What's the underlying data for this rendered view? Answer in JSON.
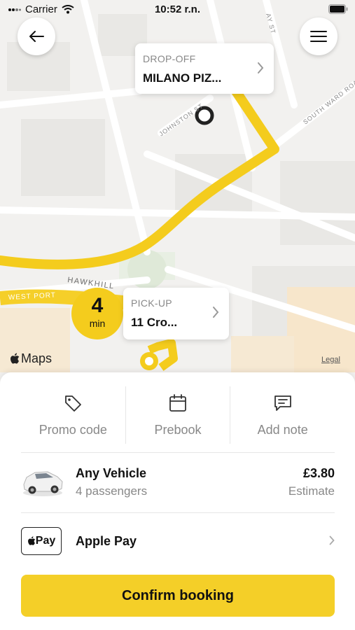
{
  "status_bar": {
    "carrier": "Carrier",
    "time": "10:52 r.n."
  },
  "map": {
    "streets": {
      "hawkhill": "HAWKHILL",
      "west_port": "WEST PORT",
      "johnston_st": "JOHNSTON ST",
      "south_ward_road": "SOUTH WARD ROA",
      "top_street_fragment": "AY ST"
    },
    "dropoff": {
      "label": "DROP-OFF",
      "value": "MILANO PIZ..."
    },
    "pickup": {
      "label": "PICK-UP",
      "value": "11 Cro..."
    },
    "eta": {
      "number": "4",
      "unit": "min"
    },
    "maps_brand": "Maps",
    "legal": "Legal",
    "route_color": "#f4cc1d"
  },
  "actions": [
    {
      "label": "Promo code",
      "icon": "tag-icon"
    },
    {
      "label": "Prebook",
      "icon": "calendar-icon"
    },
    {
      "label": "Add note",
      "icon": "note-icon"
    }
  ],
  "vehicle": {
    "name": "Any Vehicle",
    "passengers": "4 passengers",
    "price": "£3.80",
    "price_note": "Estimate"
  },
  "payment": {
    "badge": "Pay",
    "method": "Apple Pay"
  },
  "confirm_label": "Confirm booking",
  "colors": {
    "accent": "#f4cf28",
    "muted_text": "#888888"
  }
}
